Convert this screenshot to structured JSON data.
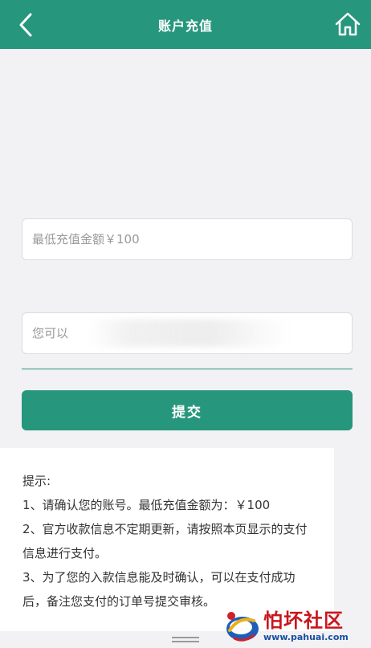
{
  "header": {
    "title": "账户充值"
  },
  "form": {
    "amount_placeholder": "最低充值金额￥100",
    "account_placeholder": "您可以",
    "submit_label": "提交"
  },
  "tips": {
    "heading": "提示:",
    "lines": [
      "1、请确认您的账号。最低充值金额为：￥100",
      "2、官方收款信息不定期更新，请按照本页显示的支付信息进行支付。",
      "3、为了您的入款信息能及时确认，可以在支付成功后，备注您支付的订单号提交审核。"
    ]
  },
  "watermark": {
    "name": "怕坏社区",
    "url": "www.pahuai.com"
  },
  "colors": {
    "accent": "#26977c",
    "background": "#f2f1f4"
  },
  "icons": {
    "back": "chevron-left-icon",
    "home": "home-icon"
  }
}
